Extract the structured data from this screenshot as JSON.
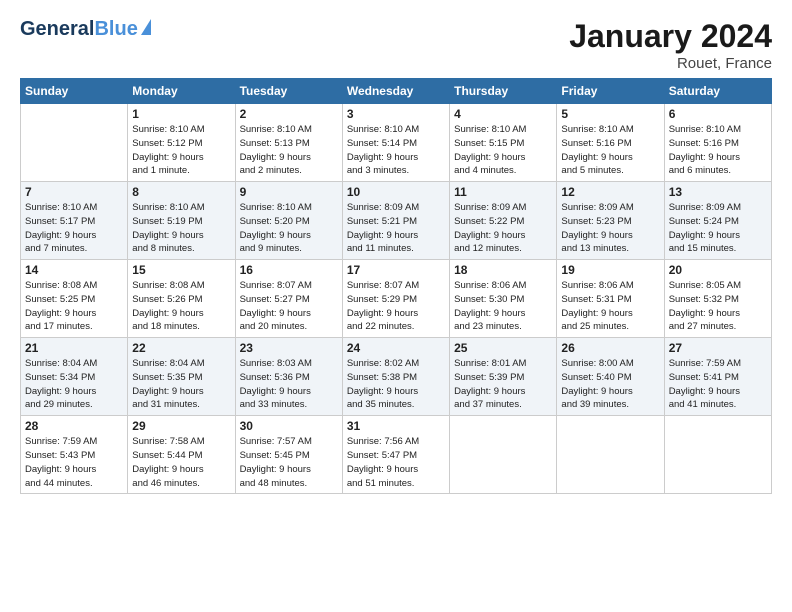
{
  "logo": {
    "line1": "General",
    "line2": "Blue"
  },
  "title": "January 2024",
  "location": "Rouet, France",
  "days_of_week": [
    "Sunday",
    "Monday",
    "Tuesday",
    "Wednesday",
    "Thursday",
    "Friday",
    "Saturday"
  ],
  "weeks": [
    [
      {
        "num": "",
        "info": ""
      },
      {
        "num": "1",
        "info": "Sunrise: 8:10 AM\nSunset: 5:12 PM\nDaylight: 9 hours\nand 1 minute."
      },
      {
        "num": "2",
        "info": "Sunrise: 8:10 AM\nSunset: 5:13 PM\nDaylight: 9 hours\nand 2 minutes."
      },
      {
        "num": "3",
        "info": "Sunrise: 8:10 AM\nSunset: 5:14 PM\nDaylight: 9 hours\nand 3 minutes."
      },
      {
        "num": "4",
        "info": "Sunrise: 8:10 AM\nSunset: 5:15 PM\nDaylight: 9 hours\nand 4 minutes."
      },
      {
        "num": "5",
        "info": "Sunrise: 8:10 AM\nSunset: 5:16 PM\nDaylight: 9 hours\nand 5 minutes."
      },
      {
        "num": "6",
        "info": "Sunrise: 8:10 AM\nSunset: 5:16 PM\nDaylight: 9 hours\nand 6 minutes."
      }
    ],
    [
      {
        "num": "7",
        "info": "Sunrise: 8:10 AM\nSunset: 5:17 PM\nDaylight: 9 hours\nand 7 minutes."
      },
      {
        "num": "8",
        "info": "Sunrise: 8:10 AM\nSunset: 5:19 PM\nDaylight: 9 hours\nand 8 minutes."
      },
      {
        "num": "9",
        "info": "Sunrise: 8:10 AM\nSunset: 5:20 PM\nDaylight: 9 hours\nand 9 minutes."
      },
      {
        "num": "10",
        "info": "Sunrise: 8:09 AM\nSunset: 5:21 PM\nDaylight: 9 hours\nand 11 minutes."
      },
      {
        "num": "11",
        "info": "Sunrise: 8:09 AM\nSunset: 5:22 PM\nDaylight: 9 hours\nand 12 minutes."
      },
      {
        "num": "12",
        "info": "Sunrise: 8:09 AM\nSunset: 5:23 PM\nDaylight: 9 hours\nand 13 minutes."
      },
      {
        "num": "13",
        "info": "Sunrise: 8:09 AM\nSunset: 5:24 PM\nDaylight: 9 hours\nand 15 minutes."
      }
    ],
    [
      {
        "num": "14",
        "info": "Sunrise: 8:08 AM\nSunset: 5:25 PM\nDaylight: 9 hours\nand 17 minutes."
      },
      {
        "num": "15",
        "info": "Sunrise: 8:08 AM\nSunset: 5:26 PM\nDaylight: 9 hours\nand 18 minutes."
      },
      {
        "num": "16",
        "info": "Sunrise: 8:07 AM\nSunset: 5:27 PM\nDaylight: 9 hours\nand 20 minutes."
      },
      {
        "num": "17",
        "info": "Sunrise: 8:07 AM\nSunset: 5:29 PM\nDaylight: 9 hours\nand 22 minutes."
      },
      {
        "num": "18",
        "info": "Sunrise: 8:06 AM\nSunset: 5:30 PM\nDaylight: 9 hours\nand 23 minutes."
      },
      {
        "num": "19",
        "info": "Sunrise: 8:06 AM\nSunset: 5:31 PM\nDaylight: 9 hours\nand 25 minutes."
      },
      {
        "num": "20",
        "info": "Sunrise: 8:05 AM\nSunset: 5:32 PM\nDaylight: 9 hours\nand 27 minutes."
      }
    ],
    [
      {
        "num": "21",
        "info": "Sunrise: 8:04 AM\nSunset: 5:34 PM\nDaylight: 9 hours\nand 29 minutes."
      },
      {
        "num": "22",
        "info": "Sunrise: 8:04 AM\nSunset: 5:35 PM\nDaylight: 9 hours\nand 31 minutes."
      },
      {
        "num": "23",
        "info": "Sunrise: 8:03 AM\nSunset: 5:36 PM\nDaylight: 9 hours\nand 33 minutes."
      },
      {
        "num": "24",
        "info": "Sunrise: 8:02 AM\nSunset: 5:38 PM\nDaylight: 9 hours\nand 35 minutes."
      },
      {
        "num": "25",
        "info": "Sunrise: 8:01 AM\nSunset: 5:39 PM\nDaylight: 9 hours\nand 37 minutes."
      },
      {
        "num": "26",
        "info": "Sunrise: 8:00 AM\nSunset: 5:40 PM\nDaylight: 9 hours\nand 39 minutes."
      },
      {
        "num": "27",
        "info": "Sunrise: 7:59 AM\nSunset: 5:41 PM\nDaylight: 9 hours\nand 41 minutes."
      }
    ],
    [
      {
        "num": "28",
        "info": "Sunrise: 7:59 AM\nSunset: 5:43 PM\nDaylight: 9 hours\nand 44 minutes."
      },
      {
        "num": "29",
        "info": "Sunrise: 7:58 AM\nSunset: 5:44 PM\nDaylight: 9 hours\nand 46 minutes."
      },
      {
        "num": "30",
        "info": "Sunrise: 7:57 AM\nSunset: 5:45 PM\nDaylight: 9 hours\nand 48 minutes."
      },
      {
        "num": "31",
        "info": "Sunrise: 7:56 AM\nSunset: 5:47 PM\nDaylight: 9 hours\nand 51 minutes."
      },
      {
        "num": "",
        "info": ""
      },
      {
        "num": "",
        "info": ""
      },
      {
        "num": "",
        "info": ""
      }
    ]
  ]
}
